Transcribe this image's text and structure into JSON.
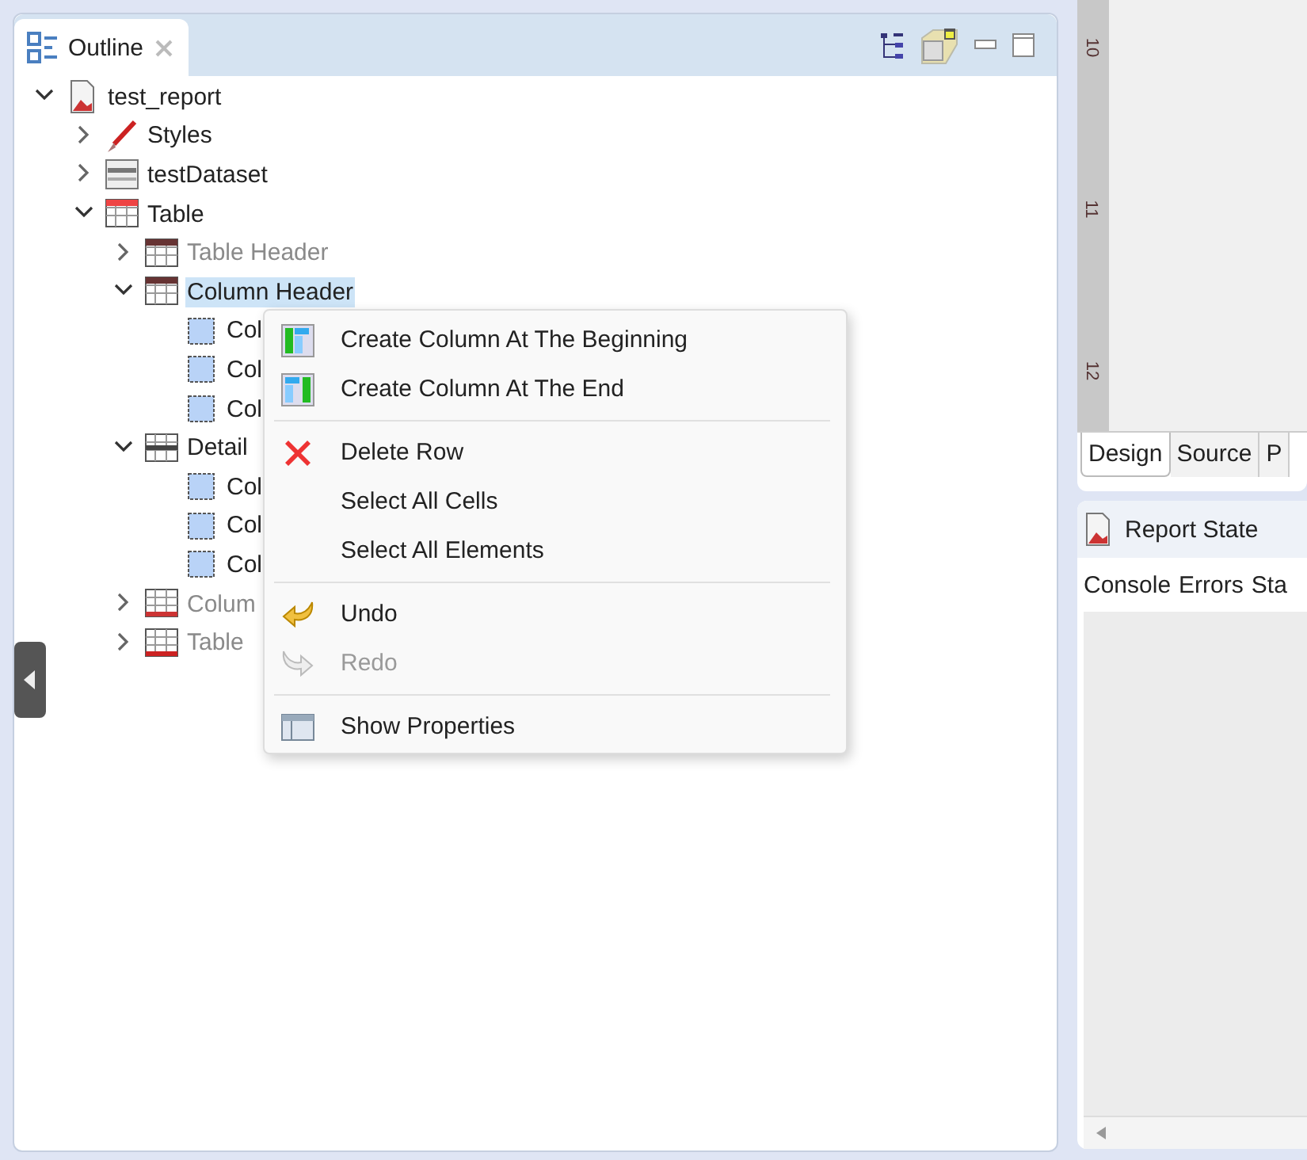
{
  "outline": {
    "title": "Outline",
    "tree": [
      {
        "label": "test_report",
        "kind": "report",
        "expanded": true,
        "selected": false,
        "disabled": false,
        "children": [
          {
            "label": "Styles",
            "kind": "styles",
            "expanded": false,
            "selected": false,
            "disabled": false
          },
          {
            "label": "testDataset",
            "kind": "dataset",
            "expanded": false,
            "selected": false,
            "disabled": false
          },
          {
            "label": "Table",
            "kind": "table",
            "expanded": true,
            "selected": false,
            "disabled": false,
            "children": [
              {
                "label": "Table Header",
                "kind": "header-row",
                "expanded": false,
                "selected": false,
                "disabled": true
              },
              {
                "label": "Column Header",
                "kind": "header-row",
                "expanded": true,
                "selected": true,
                "disabled": false,
                "children": [
                  {
                    "label": "Col",
                    "kind": "cell",
                    "selected": false,
                    "disabled": false
                  },
                  {
                    "label": "Col",
                    "kind": "cell",
                    "selected": false,
                    "disabled": false
                  },
                  {
                    "label": "Col",
                    "kind": "cell",
                    "selected": false,
                    "disabled": false
                  }
                ]
              },
              {
                "label": "Detail",
                "kind": "detail-row",
                "expanded": true,
                "selected": false,
                "disabled": false,
                "children": [
                  {
                    "label": "Col",
                    "kind": "cell",
                    "selected": false,
                    "disabled": false
                  },
                  {
                    "label": "Col",
                    "kind": "cell",
                    "selected": false,
                    "disabled": false
                  },
                  {
                    "label": "Col",
                    "kind": "cell",
                    "selected": false,
                    "disabled": false
                  }
                ]
              },
              {
                "label": "Colum",
                "kind": "footer-row",
                "expanded": false,
                "selected": false,
                "disabled": true
              },
              {
                "label": "Table",
                "kind": "table-footer",
                "expanded": false,
                "selected": false,
                "disabled": true
              }
            ]
          }
        ]
      }
    ]
  },
  "context_menu": {
    "groups": [
      [
        {
          "label": "Create Column At The Beginning",
          "kind": "column-start",
          "disabled": false
        },
        {
          "label": "Create Column At The End",
          "kind": "column-end",
          "disabled": false
        }
      ],
      [
        {
          "label": "Delete Row",
          "kind": "delete",
          "disabled": false
        },
        {
          "label": "Select All Cells",
          "kind": "plain",
          "disabled": false
        },
        {
          "label": "Select All Elements",
          "kind": "plain",
          "disabled": false
        }
      ],
      [
        {
          "label": "Undo",
          "kind": "undo",
          "disabled": false
        },
        {
          "label": "Redo",
          "kind": "redo",
          "disabled": true
        }
      ],
      [
        {
          "label": "Show Properties",
          "kind": "properties",
          "disabled": false
        }
      ]
    ]
  },
  "editor": {
    "ruler": [
      "10",
      "11",
      "12"
    ],
    "tabs": [
      {
        "label": "Design",
        "selected": true
      },
      {
        "label": "Source",
        "selected": false
      },
      {
        "label": "P",
        "selected": false
      }
    ]
  },
  "report_state": {
    "title": "Report State",
    "tabs": [
      "Console",
      "Errors",
      "Sta"
    ]
  }
}
